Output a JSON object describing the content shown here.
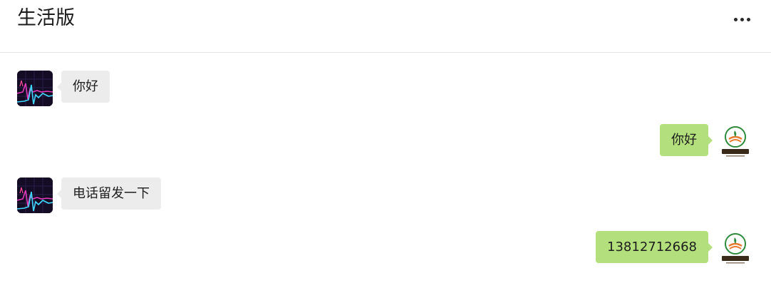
{
  "header": {
    "title": "生活版",
    "more_icon": "more-horizontal-icon"
  },
  "messages": [
    {
      "side": "left",
      "text": "你好",
      "avatar": "chart-wave-avatar"
    },
    {
      "side": "right",
      "text": "你好",
      "avatar": "company-logo-avatar"
    },
    {
      "side": "left",
      "text": "电话留发一下",
      "avatar": "chart-wave-avatar"
    },
    {
      "side": "right",
      "text": "13812712668",
      "avatar": "company-logo-avatar"
    }
  ],
  "colors": {
    "incoming_bubble": "#ececec",
    "outgoing_bubble": "#b3e07c",
    "logo_green": "#2f8a3c",
    "logo_orange": "#e8782a"
  }
}
